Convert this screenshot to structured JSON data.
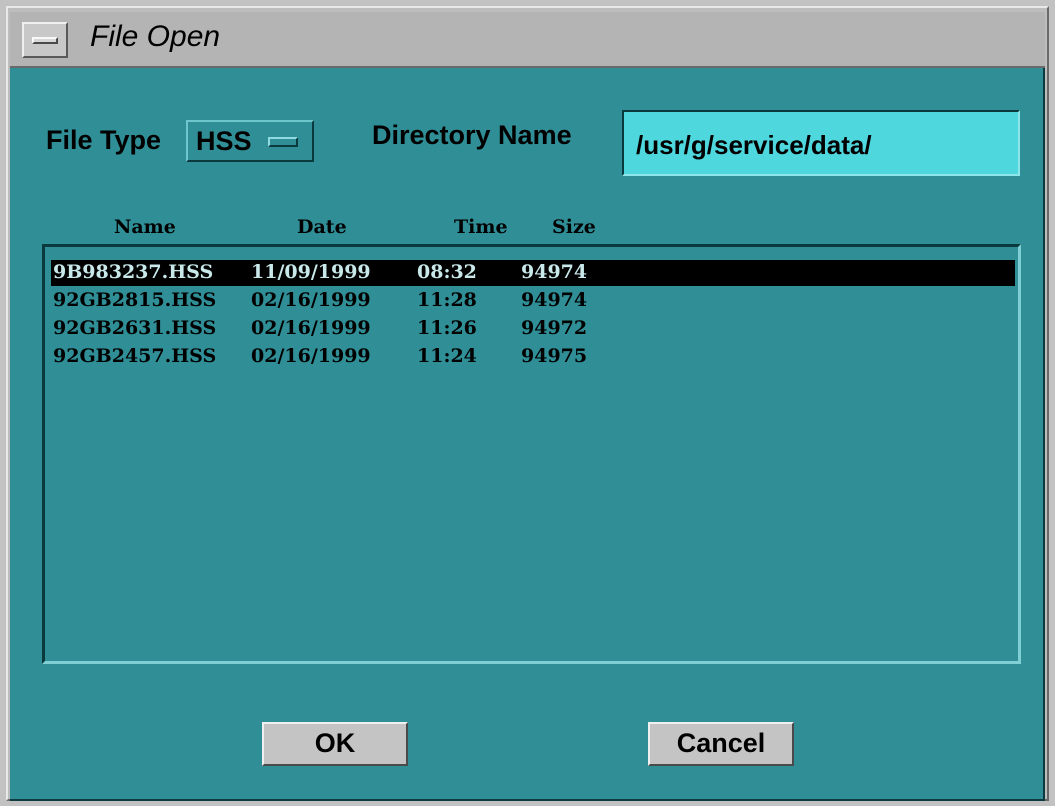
{
  "window": {
    "title": "File Open"
  },
  "form": {
    "file_type_label": "File Type",
    "file_type_value": "HSS",
    "directory_label": "Directory Name",
    "directory_value": "/usr/g/service/data/"
  },
  "columns": [
    "Name",
    "Date",
    "Time",
    "Size"
  ],
  "files": [
    {
      "name": "9B983237.HSS",
      "date": "11/09/1999",
      "time": "08:32",
      "size": "94974",
      "selected": true
    },
    {
      "name": "92GB2815.HSS",
      "date": "02/16/1999",
      "time": "11:28",
      "size": "94974",
      "selected": false
    },
    {
      "name": "92GB2631.HSS",
      "date": "02/16/1999",
      "time": "11:26",
      "size": "94972",
      "selected": false
    },
    {
      "name": "92GB2457.HSS",
      "date": "02/16/1999",
      "time": "11:24",
      "size": "94975",
      "selected": false
    }
  ],
  "buttons": {
    "ok": "OK",
    "cancel": "Cancel"
  },
  "icons": {
    "window_menu": "window-menu-icon",
    "option_indicator": "option-menu-indicator-icon"
  },
  "colors": {
    "client_bg": "#2f8e96",
    "input_bg": "#4fd7de",
    "selection_bg": "#000000"
  }
}
